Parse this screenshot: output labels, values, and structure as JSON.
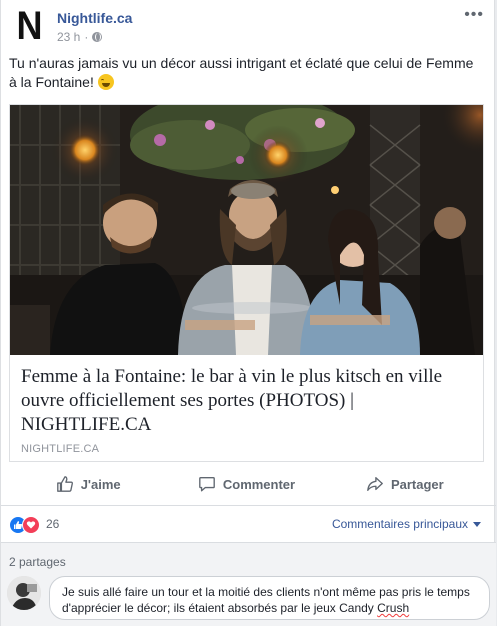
{
  "post": {
    "page_name": "Nightlife.ca",
    "logo_letter": "N",
    "timestamp": "23 h",
    "dot": "·",
    "menu": "•••",
    "text": "Tu n'auras jamais vu un décor aussi intrigant et éclaté que celui de Femme à la Fontaine!"
  },
  "link_card": {
    "title": "Femme à la Fontaine: le bar à vin le plus kitsch en ville ouvre officiellement ses portes (PHOTOS) | NIGHTLIFE.CA",
    "domain": "NIGHTLIFE.CA"
  },
  "actions": {
    "like": "J'aime",
    "comment": "Commenter",
    "share": "Partager"
  },
  "stats": {
    "reaction_count": "26",
    "top_comments": "Commentaires principaux",
    "shares": "2 partages"
  },
  "comment": {
    "text_main": "Je suis allé faire un tour et la moitié des clients n'ont même pas pris le temps d'apprécier le décor; ils étaient absorbés par le jeux Candy ",
    "text_flagged": "Crush"
  },
  "colors": {
    "link_blue": "#385898",
    "like_blue": "#1877f2",
    "love_red": "#f33e58",
    "muted": "#606770"
  }
}
